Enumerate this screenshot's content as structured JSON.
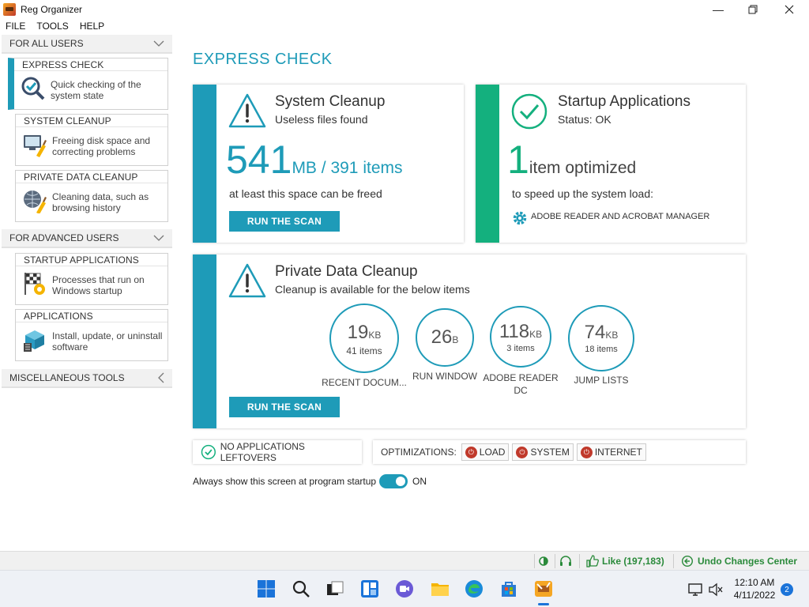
{
  "window": {
    "title": "Reg Organizer"
  },
  "menu": [
    "FILE",
    "TOOLS",
    "HELP"
  ],
  "sidebar": {
    "groups": [
      {
        "label": "FOR ALL USERS",
        "chevron": "chevron-down-icon"
      },
      {
        "label": "FOR ADVANCED USERS",
        "chevron": "chevron-down-icon"
      },
      {
        "label": "MISCELLANEOUS TOOLS",
        "chevron": "chevron-left-icon"
      }
    ],
    "items": [
      {
        "title": "EXPRESS CHECK",
        "desc": "Quick checking of the system state",
        "icon": "magnifier-check-icon",
        "active": true
      },
      {
        "title": "SYSTEM CLEANUP",
        "desc": "Freeing disk space and correcting problems",
        "icon": "broom-computer-icon"
      },
      {
        "title": "PRIVATE DATA CLEANUP",
        "desc": "Cleaning data, such as browsing history",
        "icon": "broom-globe-icon"
      },
      {
        "title": "STARTUP APPLICATIONS",
        "desc": "Processes that run on Windows startup",
        "icon": "startup-flag-icon"
      },
      {
        "title": "APPLICATIONS",
        "desc": "Install, update, or uninstall software",
        "icon": "app-box-icon"
      }
    ]
  },
  "main": {
    "title": "EXPRESS CHECK",
    "system_cleanup": {
      "title": "System Cleanup",
      "subtitle": "Useless files found",
      "size_value": "541",
      "size_unit": "MB / 391 items",
      "note": "at least this space can be freed",
      "button": "RUN THE SCAN",
      "accent": "#1e9bb8"
    },
    "startup": {
      "title": "Startup Applications",
      "subtitle": "Status: OK",
      "count_value": "1",
      "count_unit": "item optimized",
      "note": "to speed up the system load:",
      "app": "ADOBE READER AND ACROBAT MANAGER",
      "accent": "#14b07e"
    },
    "private": {
      "title": "Private Data Cleanup",
      "subtitle": "Cleanup is available for the below items",
      "button": "RUN THE SCAN",
      "items": [
        {
          "value": "19",
          "unit": "KB",
          "count": "41 items",
          "label": "RECENT DOCUM..."
        },
        {
          "value": "26",
          "unit": "B",
          "count": "",
          "label": "RUN WINDOW"
        },
        {
          "value": "118",
          "unit": "KB",
          "count": "3 items",
          "label": "ADOBE READER DC"
        },
        {
          "value": "74",
          "unit": "KB",
          "count": "18 items",
          "label": "JUMP LISTS"
        }
      ]
    },
    "leftovers": "NO APPLICATIONS LEFTOVERS",
    "optimizations": {
      "label": "OPTIMIZATIONS:",
      "buttons": [
        "LOAD",
        "SYSTEM",
        "INTERNET"
      ]
    },
    "startup_toggle": {
      "label": "Always show this screen at program startup",
      "state": "ON"
    }
  },
  "statusbar": {
    "like": "Like (197,183)",
    "undo": "Undo Changes Center"
  },
  "taskbar": {
    "time": "12:10 AM",
    "date": "4/11/2022",
    "notifications": "2"
  }
}
